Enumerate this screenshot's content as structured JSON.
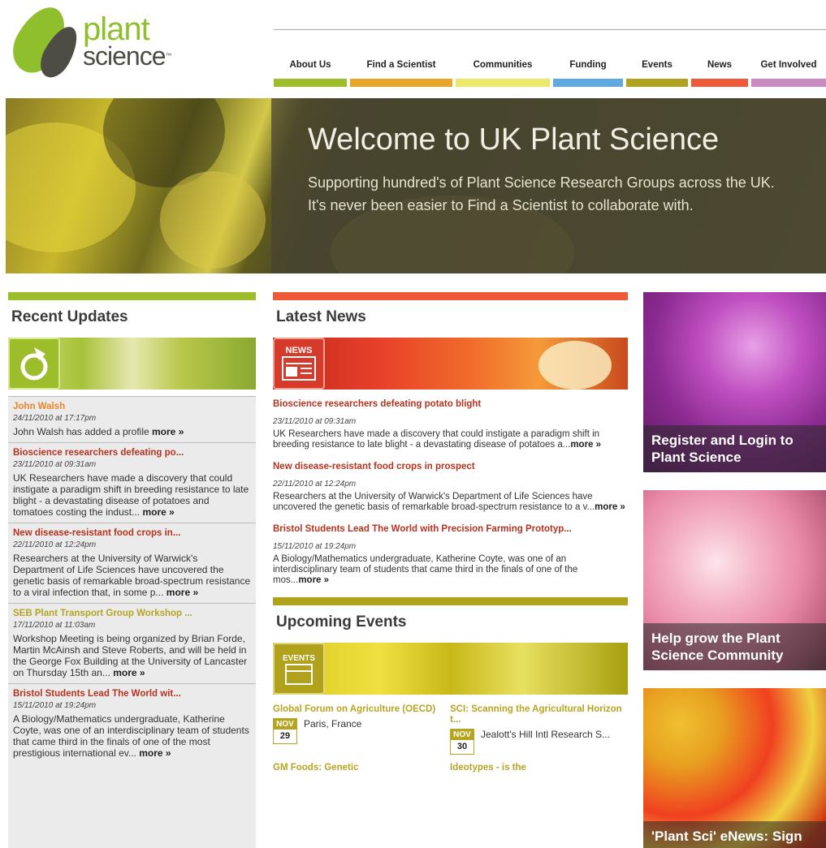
{
  "logo": {
    "word1": "plant",
    "word2": "science",
    "tm": "™"
  },
  "nav": [
    {
      "label": "About Us",
      "color": "#9dbd2a"
    },
    {
      "label": "Find a Scientist",
      "color": "#e8a62a"
    },
    {
      "label": "Communities",
      "color": "#ece86a"
    },
    {
      "label": "Funding",
      "color": "#5fa8e0"
    },
    {
      "label": "Events",
      "color": "#b0a21c"
    },
    {
      "label": "News",
      "color": "#f0583a"
    },
    {
      "label": "Get Involved",
      "color": "#c88ac0"
    }
  ],
  "hero": {
    "title": "Welcome to UK Plant Science",
    "text": "Supporting hundred's of Plant Science Research Groups across the UK. It's never been easier to Find a Scientist to collaborate with."
  },
  "recent": {
    "title": "Recent Updates",
    "color": "#9dbd2a",
    "items": [
      {
        "title": "John Walsh",
        "color": "#e8842a",
        "date": "24/11/2010 at 17:17pm",
        "text": "John Walsh has added a profile",
        "more": "more »"
      },
      {
        "title": "Bioscience researchers defeating po...",
        "color": "#b5331f",
        "date": "23/11/2010 at 09:31am",
        "text": "UK Researchers have made a discovery that could instigate a paradigm shift in breeding resistance to late blight - a devastating disease of potatoes and tomatoes costing the indust...",
        "more": "more »"
      },
      {
        "title": "New disease-resistant food crops in...",
        "color": "#b5331f",
        "date": "22/11/2010 at 12:24pm",
        "text": "Researchers at the University of Warwick's Department of Life Sciences have uncovered the genetic basis of remarkable broad-spectrum resistance to a viral infection that, in some p...",
        "more": "more »"
      },
      {
        "title": "SEB Plant Transport Group Workshop ...",
        "color": "#b5a520",
        "date": "17/11/2010 at 11:03am",
        "text": "Workshop Meeting is being organized by Brian Forde, Martin McAinsh and Steve Roberts, and will be held in the George Fox Building at the University of Lancaster on Thursday 15th an...",
        "more": "more »"
      },
      {
        "title": "Bristol Students Lead The World wit...",
        "color": "#b5331f",
        "date": "15/11/2010 at 19:24pm",
        "text": "A Biology/Mathematics undergraduate, Katherine Coyte, was one of an interdisciplinary team of students that came third in the finals of one of the most prestigious international ev...",
        "more": "more »"
      }
    ]
  },
  "news": {
    "title": "Latest News",
    "color": "#f0583a",
    "badge": "NEWS",
    "items": [
      {
        "title": "Bioscience researchers defeating potato blight",
        "date": "23/11/2010 at 09:31am",
        "text": "UK Researchers have made a discovery that could instigate a paradigm shift in breeding resistance to late blight - a devastating disease of potatoes a...",
        "more": "more »"
      },
      {
        "title": "New disease-resistant food crops in prospect",
        "date": "22/11/2010 at 12:24pm",
        "text": "Researchers at the University of Warwick's Department of Life Sciences have uncovered the genetic basis of remarkable broad-spectrum resistance to a v...",
        "more": "more »"
      },
      {
        "title": "Bristol Students Lead The World with Precision Farming Prototyp...",
        "date": "15/11/2010 at 19:24pm",
        "text": "A Biology/Mathematics undergraduate, Katherine Coyte, was one of an interdisciplinary team of students that came third in the finals of one of the mos...",
        "more": "more »"
      }
    ]
  },
  "events": {
    "title": "Upcoming Events",
    "color": "#b0a21c",
    "badge": "EVENTS",
    "items": [
      {
        "title": "Global Forum on Agriculture (OECD)",
        "month": "NOV",
        "day": "29",
        "place": "Paris, France"
      },
      {
        "title": "SCI: Scanning the Agricultural Horizon t...",
        "month": "NOV",
        "day": "30",
        "place": "Jealott's Hill Intl Research S..."
      },
      {
        "title": "GM Foods: Genetic",
        "month": "",
        "day": "",
        "place": ""
      },
      {
        "title": "Ideotypes - is the",
        "month": "",
        "day": "",
        "place": ""
      }
    ]
  },
  "promos": [
    {
      "caption": "Register and Login to Plant Science"
    },
    {
      "caption": "Help grow the Plant Science Community"
    },
    {
      "caption": "'Plant Sci' eNews: Sign up"
    }
  ]
}
